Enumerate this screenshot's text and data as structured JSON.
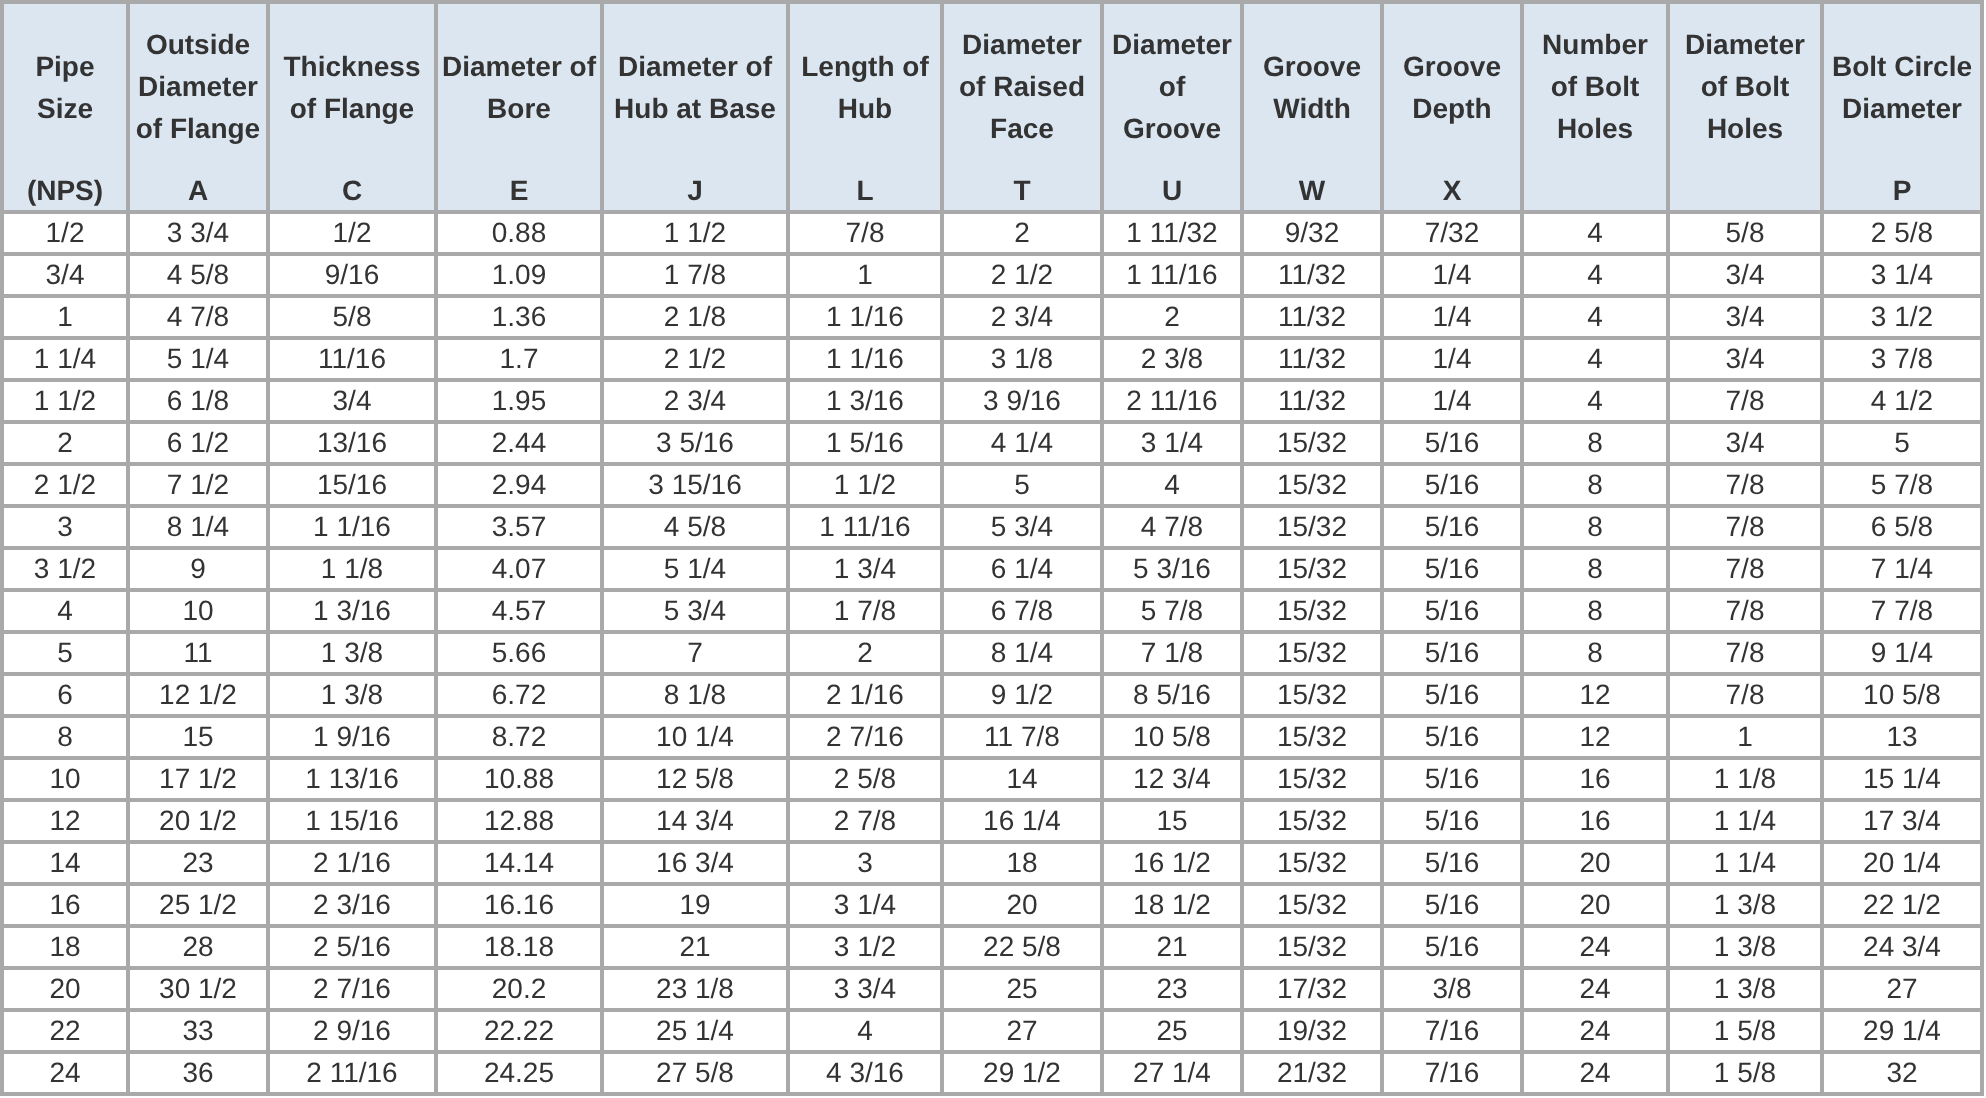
{
  "table": {
    "columns": [
      {
        "title": "Pipe Size",
        "symbol": "(NPS)"
      },
      {
        "title": "Outside Diameter of Flange",
        "symbol": "A"
      },
      {
        "title": "Thickness of Flange",
        "symbol": "C"
      },
      {
        "title": "Diameter of Bore",
        "symbol": "E"
      },
      {
        "title": "Diameter of Hub at Base",
        "symbol": "J"
      },
      {
        "title": "Length of Hub",
        "symbol": "L"
      },
      {
        "title": "Diameter of Raised Face",
        "symbol": "T"
      },
      {
        "title": "Diameter of Groove",
        "symbol": "U"
      },
      {
        "title": "Groove Width",
        "symbol": "W"
      },
      {
        "title": "Groove Depth",
        "symbol": "X"
      },
      {
        "title": "Number of Bolt Holes"
      },
      {
        "title": "Diameter of Bolt Holes"
      },
      {
        "title": "Bolt Circle Diameter",
        "symbol": "P"
      }
    ],
    "rows": [
      [
        "1/2",
        "3 3/4",
        "1/2",
        "0.88",
        "1 1/2",
        "7/8",
        "2",
        "1 11/32",
        "9/32",
        "7/32",
        "4",
        "5/8",
        "2 5/8"
      ],
      [
        "3/4",
        "4 5/8",
        "9/16",
        "1.09",
        "1 7/8",
        "1",
        "2 1/2",
        "1 11/16",
        "11/32",
        "1/4",
        "4",
        "3/4",
        "3 1/4"
      ],
      [
        "1",
        "4 7/8",
        "5/8",
        "1.36",
        "2 1/8",
        "1 1/16",
        "2 3/4",
        "2",
        "11/32",
        "1/4",
        "4",
        "3/4",
        "3 1/2"
      ],
      [
        "1 1/4",
        "5 1/4",
        "11/16",
        "1.7",
        "2 1/2",
        "1 1/16",
        "3 1/8",
        "2 3/8",
        "11/32",
        "1/4",
        "4",
        "3/4",
        "3 7/8"
      ],
      [
        "1 1/2",
        "6 1/8",
        "3/4",
        "1.95",
        "2 3/4",
        "1 3/16",
        "3 9/16",
        "2 11/16",
        "11/32",
        "1/4",
        "4",
        "7/8",
        "4 1/2"
      ],
      [
        "2",
        "6 1/2",
        "13/16",
        "2.44",
        "3 5/16",
        "1 5/16",
        "4 1/4",
        "3 1/4",
        "15/32",
        "5/16",
        "8",
        "3/4",
        "5"
      ],
      [
        "2 1/2",
        "7 1/2",
        "15/16",
        "2.94",
        "3 15/16",
        "1 1/2",
        "5",
        "4",
        "15/32",
        "5/16",
        "8",
        "7/8",
        "5 7/8"
      ],
      [
        "3",
        "8 1/4",
        "1 1/16",
        "3.57",
        "4 5/8",
        "1 11/16",
        "5 3/4",
        "4 7/8",
        "15/32",
        "5/16",
        "8",
        "7/8",
        "6 5/8"
      ],
      [
        "3 1/2",
        "9",
        "1 1/8",
        "4.07",
        "5 1/4",
        "1 3/4",
        "6 1/4",
        "5 3/16",
        "15/32",
        "5/16",
        "8",
        "7/8",
        "7 1/4"
      ],
      [
        "4",
        "10",
        "1 3/16",
        "4.57",
        "5 3/4",
        "1 7/8",
        "6 7/8",
        "5 7/8",
        "15/32",
        "5/16",
        "8",
        "7/8",
        "7 7/8"
      ],
      [
        "5",
        "11",
        "1 3/8",
        "5.66",
        "7",
        "2",
        "8 1/4",
        "7 1/8",
        "15/32",
        "5/16",
        "8",
        "7/8",
        "9 1/4"
      ],
      [
        "6",
        "12 1/2",
        "1 3/8",
        "6.72",
        "8 1/8",
        "2 1/16",
        "9 1/2",
        "8 5/16",
        "15/32",
        "5/16",
        "12",
        "7/8",
        "10 5/8"
      ],
      [
        "8",
        "15",
        "1 9/16",
        "8.72",
        "10 1/4",
        "2 7/16",
        "11 7/8",
        "10 5/8",
        "15/32",
        "5/16",
        "12",
        "1",
        "13"
      ],
      [
        "10",
        "17 1/2",
        "1 13/16",
        "10.88",
        "12 5/8",
        "2 5/8",
        "14",
        "12 3/4",
        "15/32",
        "5/16",
        "16",
        "1 1/8",
        "15 1/4"
      ],
      [
        "12",
        "20 1/2",
        "1 15/16",
        "12.88",
        "14 3/4",
        "2 7/8",
        "16 1/4",
        "15",
        "15/32",
        "5/16",
        "16",
        "1 1/4",
        "17 3/4"
      ],
      [
        "14",
        "23",
        "2 1/16",
        "14.14",
        "16 3/4",
        "3",
        "18",
        "16 1/2",
        "15/32",
        "5/16",
        "20",
        "1 1/4",
        "20 1/4"
      ],
      [
        "16",
        "25 1/2",
        "2 3/16",
        "16.16",
        "19",
        "3 1/4",
        "20",
        "18 1/2",
        "15/32",
        "5/16",
        "20",
        "1 3/8",
        "22 1/2"
      ],
      [
        "18",
        "28",
        "2 5/16",
        "18.18",
        "21",
        "3 1/2",
        "22 5/8",
        "21",
        "15/32",
        "5/16",
        "24",
        "1 3/8",
        "24 3/4"
      ],
      [
        "20",
        "30 1/2",
        "2 7/16",
        "20.2",
        "23 1/8",
        "3 3/4",
        "25",
        "23",
        "17/32",
        "3/8",
        "24",
        "1 3/8",
        "27"
      ],
      [
        "22",
        "33",
        "2 9/16",
        "22.22",
        "25 1/4",
        "4",
        "27",
        "25",
        "19/32",
        "7/16",
        "24",
        "1 5/8",
        "29 1/4"
      ],
      [
        "24",
        "36",
        "2 11/16",
        "24.25",
        "27 5/8",
        "4 3/16",
        "29 1/2",
        "27 1/4",
        "21/32",
        "7/16",
        "24",
        "1 5/8",
        "32"
      ]
    ]
  }
}
